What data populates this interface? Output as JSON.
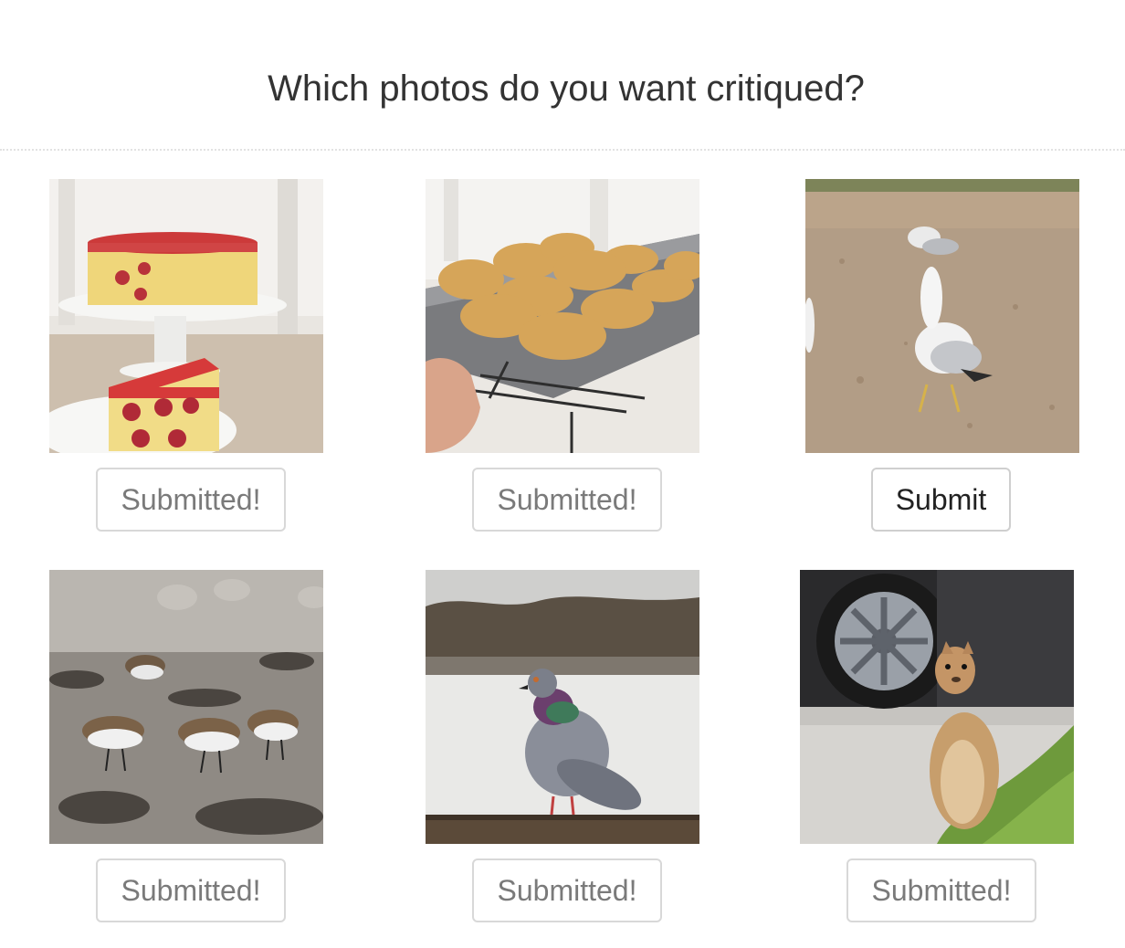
{
  "header": {
    "title": "Which photos do you want critiqued?"
  },
  "photos": [
    {
      "subject": "raspberry cake",
      "button_label": "Submitted!",
      "state": "submitted"
    },
    {
      "subject": "cupcakes on cooling rack",
      "button_label": "Submitted!",
      "state": "submitted"
    },
    {
      "subject": "seagulls",
      "button_label": "Submit",
      "state": "available"
    },
    {
      "subject": "sandpipers on mudflat",
      "button_label": "Submitted!",
      "state": "submitted"
    },
    {
      "subject": "pigeon on post",
      "button_label": "Submitted!",
      "state": "submitted"
    },
    {
      "subject": "squirrel by car",
      "button_label": "Submitted!",
      "state": "submitted"
    }
  ],
  "colors": {
    "button_text_submitted": "#7a7a7a",
    "button_text_active": "#222222",
    "button_border": "#d8d8d8"
  }
}
